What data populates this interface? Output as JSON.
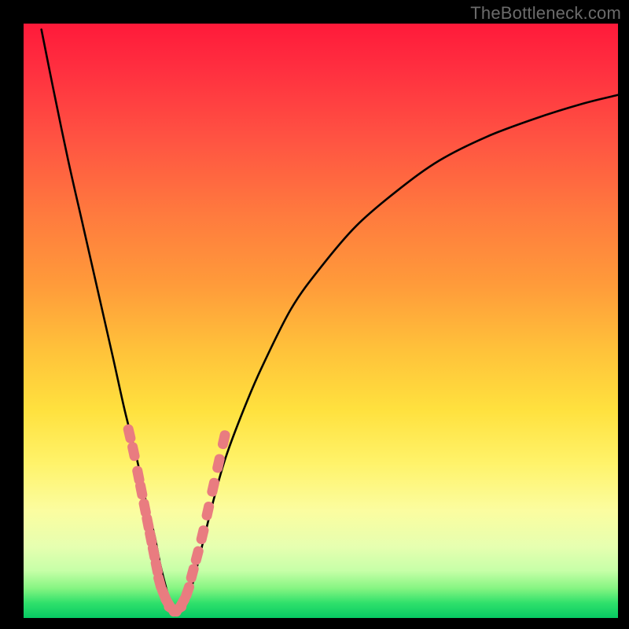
{
  "watermark": "TheBottleneck.com",
  "colors": {
    "gradient_top": "#ff1a3a",
    "gradient_mid1": "#ff9b3a",
    "gradient_mid2": "#fff36a",
    "gradient_bottom": "#07ca63",
    "curve": "#000000",
    "markers": "#e97c80",
    "frame": "#000000"
  },
  "chart_data": {
    "type": "line",
    "title": "",
    "xlabel": "",
    "ylabel": "",
    "xlim": [
      0,
      100
    ],
    "ylim": [
      0,
      100
    ],
    "grid": false,
    "series": [
      {
        "name": "left-arm",
        "x": [
          3.0,
          5.0,
          7.5,
          10.0,
          12.5,
          15.0,
          17.0,
          19.0,
          20.5,
          22.0,
          23.0,
          24.0,
          25.0
        ],
        "values": [
          99.0,
          89.0,
          77.0,
          66.0,
          55.0,
          44.0,
          35.0,
          27.0,
          20.0,
          14.0,
          9.0,
          5.0,
          1.5
        ]
      },
      {
        "name": "right-arm",
        "x": [
          27.0,
          28.5,
          30.0,
          32.0,
          34.0,
          37.0,
          40.0,
          45.0,
          50.0,
          56.0,
          63.0,
          70.0,
          78.0,
          86.0,
          94.0,
          100.0
        ],
        "values": [
          1.5,
          6.0,
          12.0,
          20.0,
          27.0,
          35.0,
          42.0,
          52.0,
          59.0,
          66.0,
          72.0,
          77.0,
          81.0,
          84.0,
          86.5,
          88.0
        ]
      }
    ],
    "markers": {
      "name": "pink-beads",
      "x": [
        17.8,
        18.5,
        19.3,
        19.8,
        20.4,
        20.9,
        21.4,
        21.9,
        22.4,
        22.9,
        23.6,
        24.3,
        25.1,
        25.9,
        26.7,
        27.6,
        28.4,
        29.2,
        30.1,
        31.0,
        31.9,
        32.8,
        33.7
      ],
      "values": [
        31.0,
        28.0,
        24.0,
        21.5,
        18.5,
        16.0,
        13.5,
        11.0,
        8.5,
        6.0,
        4.0,
        2.5,
        1.5,
        1.5,
        2.5,
        4.5,
        7.5,
        10.5,
        14.0,
        18.0,
        22.0,
        26.0,
        30.0
      ]
    }
  }
}
